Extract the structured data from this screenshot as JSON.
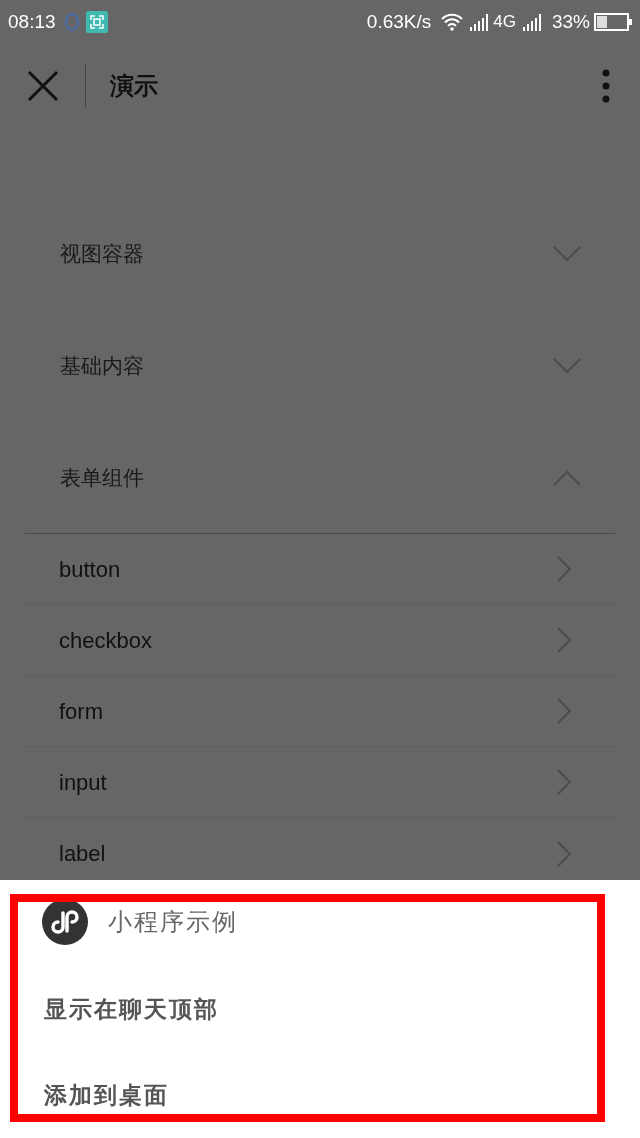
{
  "status_bar": {
    "time": "08:13",
    "speed": "0.63K/s",
    "network": "4G",
    "battery": "33%"
  },
  "nav": {
    "title": "演示"
  },
  "sections": [
    {
      "title": "视图容器",
      "expanded": false
    },
    {
      "title": "基础内容",
      "expanded": false
    },
    {
      "title": "表单组件",
      "expanded": true,
      "items": [
        "button",
        "checkbox",
        "form",
        "input",
        "label"
      ]
    }
  ],
  "sheet": {
    "app_name": "小程序示例",
    "actions": [
      "显示在聊天顶部",
      "添加到桌面"
    ]
  }
}
